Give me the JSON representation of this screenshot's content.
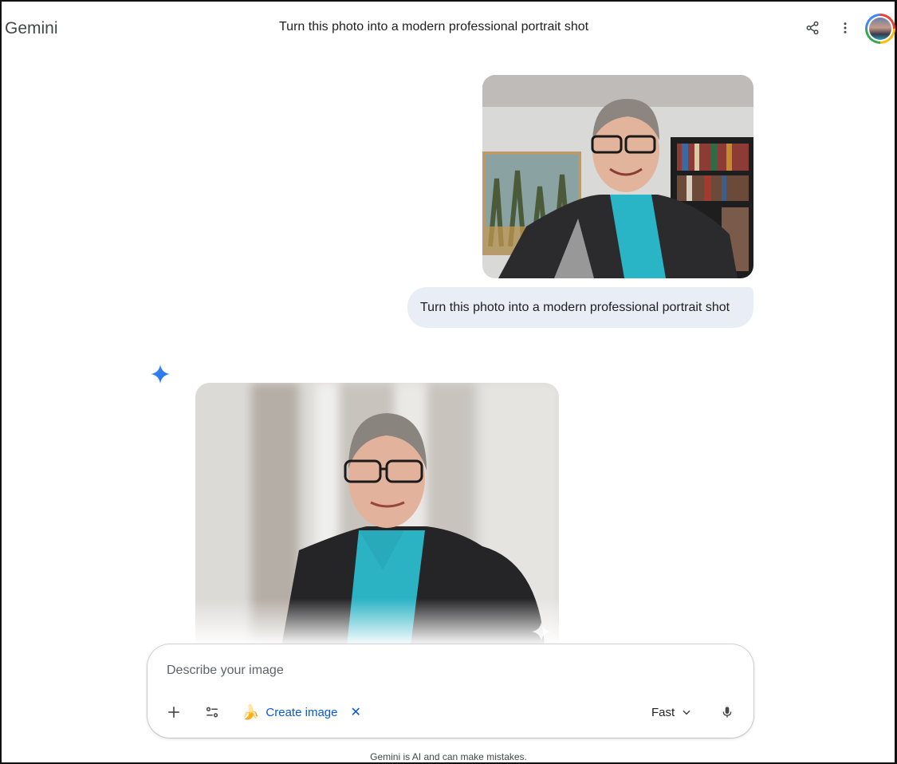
{
  "app": {
    "name": "Gemini"
  },
  "header": {
    "conversation_title": "Turn this photo into a modern professional portrait shot",
    "icons": {
      "share": "share-icon",
      "more": "more-vert-icon"
    }
  },
  "conversation": {
    "user_message": {
      "attachment": "user-uploaded photo",
      "text": "Turn this photo into a modern professional portrait shot"
    },
    "response": {
      "icon": "gemini-sparkle-icon",
      "image": "generated professional portrait"
    }
  },
  "composer": {
    "placeholder": "Describe your image",
    "tool_chip": {
      "emoji": "🍌",
      "label": "Create image",
      "close": "✕"
    },
    "model_label": "Fast"
  },
  "footer": {
    "disclaimer": "Gemini is AI and can make mistakes."
  },
  "colors": {
    "accent": "#0b57d0",
    "bubble": "#e9eef6",
    "spark": "#4285f4"
  }
}
